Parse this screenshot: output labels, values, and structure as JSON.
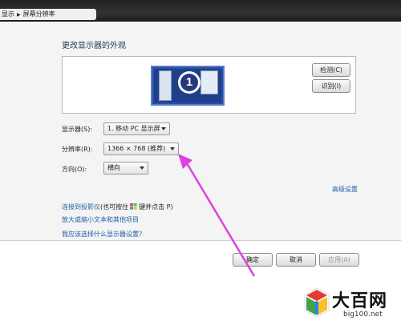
{
  "breadcrumb": {
    "parent": "显示",
    "current": "屏幕分辨率"
  },
  "heading": "更改显示器的外观",
  "monitor_preview": {
    "number": "1"
  },
  "buttons": {
    "detect": "检测(C)",
    "identify": "识别(I)"
  },
  "settings": {
    "display_label": "显示器(S):",
    "display_value": "1. 移动 PC 显示屏",
    "resolution_label": "分辨率(R):",
    "resolution_value": "1366 × 768 (推荐)",
    "orientation_label": "方向(O):",
    "orientation_value": "横向"
  },
  "advanced_link": "高级设置",
  "links": {
    "projector_link": "连接到投影仪",
    "projector_hint_prefix": "(也可按住",
    "projector_hint_suffix": "键并点击 P)",
    "text_size": "放大或缩小文本和其他项目",
    "which_settings": "我应该选择什么显示器设置?"
  },
  "dialog_buttons": {
    "ok": "确定",
    "cancel": "取消",
    "apply": "应用(A)"
  },
  "watermark": {
    "brand": "大百网",
    "domain": "big100.net"
  },
  "colors": {
    "arrow": "#e040e0",
    "link": "#1f5fa8",
    "monitor": "#1d3f8c"
  },
  "icons": [
    "chevron-right-icon",
    "windows-logo-icon",
    "monitor-icon",
    "dropdown-caret-icon",
    "annotation-arrow-icon",
    "watermark-logo-icon"
  ]
}
